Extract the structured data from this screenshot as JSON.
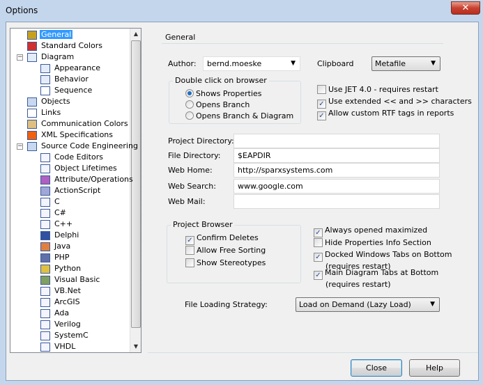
{
  "window": {
    "title": "Options",
    "close_glyph": "✕"
  },
  "tree": {
    "items": [
      {
        "label": "General",
        "level": 0,
        "icon": "general-settings-icon",
        "color": "#c8a020",
        "selected": true
      },
      {
        "label": "Standard Colors",
        "level": 0,
        "icon": "colors-icon",
        "color": "#d03030"
      },
      {
        "label": "Diagram",
        "level": 0,
        "icon": "diagram-icon",
        "color": "#e4ecfa",
        "expanded": true
      },
      {
        "label": "Appearance",
        "level": 1,
        "icon": "diagram-icon",
        "color": "#e4ecfa"
      },
      {
        "label": "Behavior",
        "level": 1,
        "icon": "diagram-icon",
        "color": "#e4ecfa"
      },
      {
        "label": "Sequence",
        "level": 1,
        "icon": "sequence-icon",
        "color": "#ffffff"
      },
      {
        "label": "Objects",
        "level": 0,
        "icon": "objects-icon",
        "color": "#c8d8f0"
      },
      {
        "label": "Links",
        "level": 0,
        "icon": "links-icon",
        "color": "#ffffff"
      },
      {
        "label": "Communication Colors",
        "level": 0,
        "icon": "palette-icon",
        "color": "#e0c080"
      },
      {
        "label": "XML Specifications",
        "level": 0,
        "icon": "xml-icon",
        "color": "#f06010"
      },
      {
        "label": "Source Code Engineering",
        "level": 0,
        "icon": "source-code-icon",
        "color": "#c8d8f0",
        "expanded": true
      },
      {
        "label": "Code Editors",
        "level": 1,
        "icon": "code-editor-icon",
        "color": "#f4f4ff"
      },
      {
        "label": "Object Lifetimes",
        "level": 1,
        "icon": "code-editor-icon",
        "color": "#f4f4ff"
      },
      {
        "label": "Attribute/Operations",
        "level": 1,
        "icon": "attribute-icon",
        "color": "#b060c0"
      },
      {
        "label": "ActionScript",
        "level": 1,
        "icon": "actionscript-icon",
        "color": "#a0a8d8"
      },
      {
        "label": "C",
        "level": 1,
        "icon": "c-language-icon",
        "color": "#f4f4ff"
      },
      {
        "label": "C#",
        "level": 1,
        "icon": "csharp-icon",
        "color": "#f4f4ff"
      },
      {
        "label": "C++",
        "level": 1,
        "icon": "cpp-icon",
        "color": "#f4f4ff"
      },
      {
        "label": "Delphi",
        "level": 1,
        "icon": "delphi-icon",
        "color": "#3050a0"
      },
      {
        "label": "Java",
        "level": 1,
        "icon": "java-icon",
        "color": "#e08040"
      },
      {
        "label": "PHP",
        "level": 1,
        "icon": "php-icon",
        "color": "#6070a8"
      },
      {
        "label": "Python",
        "level": 1,
        "icon": "python-icon",
        "color": "#e0c040"
      },
      {
        "label": "Visual Basic",
        "level": 1,
        "icon": "visual-basic-icon",
        "color": "#80a060"
      },
      {
        "label": "VB.Net",
        "level": 1,
        "icon": "vbnet-icon",
        "color": "#f4f4ff"
      },
      {
        "label": "ArcGIS",
        "level": 1,
        "icon": "code-editor-icon",
        "color": "#f4f4ff"
      },
      {
        "label": "Ada",
        "level": 1,
        "icon": "code-editor-icon",
        "color": "#f4f4ff"
      },
      {
        "label": "Verilog",
        "level": 1,
        "icon": "code-editor-icon",
        "color": "#f4f4ff"
      },
      {
        "label": "SystemC",
        "level": 1,
        "icon": "code-editor-icon",
        "color": "#f4f4ff"
      },
      {
        "label": "VHDL",
        "level": 1,
        "icon": "code-editor-icon",
        "color": "#f4f4ff"
      }
    ]
  },
  "general": {
    "heading": "General",
    "author_label": "Author:",
    "author_value": "bernd.moeske",
    "clipboard_label": "Clipboard",
    "clipboard_value": "Metafile",
    "double_click": {
      "legend": "Double click on browser",
      "options": [
        {
          "label": "Shows Properties",
          "selected": true
        },
        {
          "label": "Opens Branch",
          "selected": false
        },
        {
          "label": "Opens Branch  & Diagram",
          "selected": false
        }
      ]
    },
    "top_checks": [
      {
        "label": "Use JET 4.0 - requires restart",
        "checked": false
      },
      {
        "label": "Use extended << and >> characters",
        "checked": true
      },
      {
        "label": "Allow custom RTF tags in reports",
        "checked": true
      }
    ],
    "fields": [
      {
        "label": "Project Directory:",
        "value": ""
      },
      {
        "label": "File Directory:",
        "value": "$EAPDIR"
      },
      {
        "label": "Web Home:",
        "value": "http://sparxsystems.com"
      },
      {
        "label": "Web Search:",
        "value": "www.google.com"
      },
      {
        "label": "Web Mail:",
        "value": ""
      }
    ],
    "project_browser": {
      "legend": "Project Browser",
      "checks": [
        {
          "label": "Confirm Deletes",
          "checked": true
        },
        {
          "label": "Allow Free Sorting",
          "checked": false
        },
        {
          "label": "Show Stereotypes",
          "checked": false
        }
      ]
    },
    "right_checks": [
      {
        "label": "Always opened maximized",
        "checked": true
      },
      {
        "label": "Hide Properties Info Section",
        "checked": false
      },
      {
        "label": "Docked Windows Tabs on Bottom",
        "sub": "(requires restart)",
        "checked": true
      },
      {
        "label": "Main Diagram Tabs at Bottom",
        "sub": "(requires restart)",
        "checked": true
      }
    ],
    "loading_label": "File Loading Strategy:",
    "loading_value": "Load on Demand (Lazy Load)"
  },
  "buttons": {
    "close": "Close",
    "help": "Help"
  }
}
